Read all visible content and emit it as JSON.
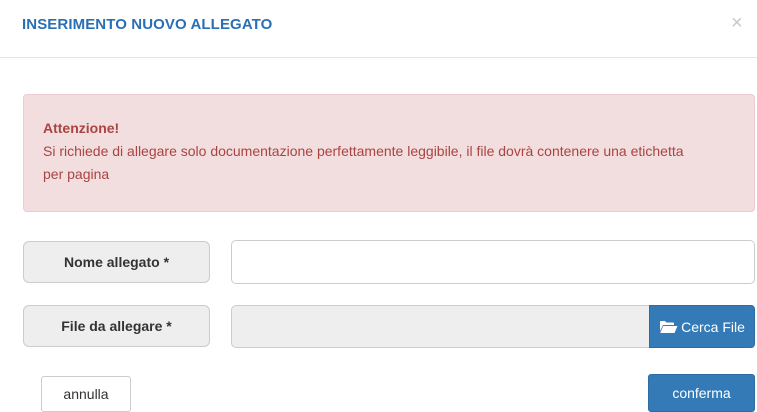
{
  "modal": {
    "title": "INSERIMENTO NUOVO ALLEGATO",
    "close_symbol": "×"
  },
  "alert": {
    "title": "Attenzione!",
    "text": "Si richiede di allegare solo documentazione perfettamente leggibile, il file dovrà contenere una etichetta per pagina"
  },
  "form": {
    "name_label": "Nome allegato *",
    "name_value": "",
    "file_label": "File da allegare *",
    "file_value": "",
    "browse_label": "Cerca File",
    "browse_icon": "folder-open-icon"
  },
  "actions": {
    "cancel_label": "annulla",
    "confirm_label": "conferma"
  },
  "colors": {
    "title": "#2a6fb5",
    "alert_bg": "#f2dede",
    "alert_text": "#a94442",
    "primary": "#337ab7"
  }
}
